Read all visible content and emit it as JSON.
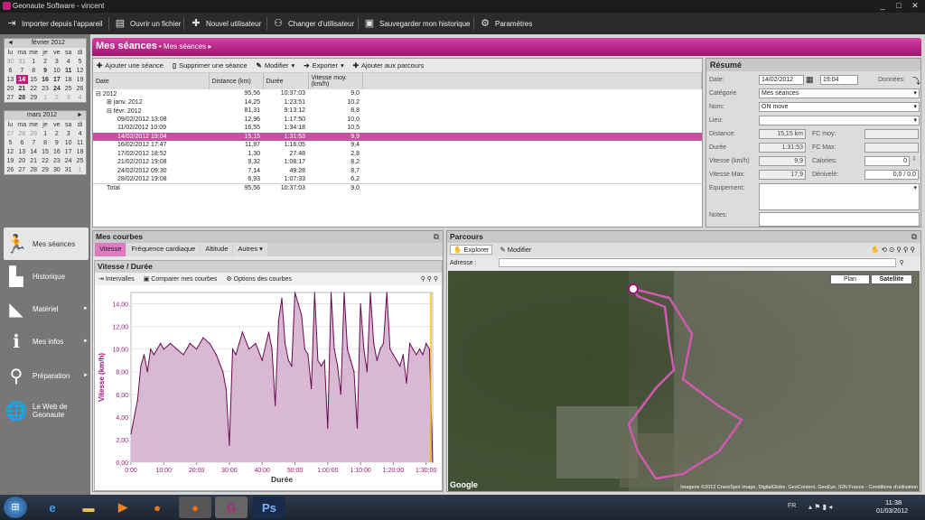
{
  "window": {
    "title": "Geonaute Software - vincent",
    "btn_min": "_",
    "btn_max": "□",
    "btn_close": "✕"
  },
  "toolbar": {
    "items": [
      {
        "label": "Importer depuis l'appareil",
        "icon": "import-icon"
      },
      {
        "label": "Ouvrir un fichier",
        "icon": "open-file-icon"
      },
      {
        "label": "Nouvel utilisateur",
        "icon": "new-user-icon"
      },
      {
        "label": "Changer d'utilisateur",
        "icon": "change-user-icon"
      },
      {
        "label": "Sauvegarder mon historique",
        "icon": "save-icon"
      },
      {
        "label": "Paramètres",
        "icon": "settings-icon"
      }
    ]
  },
  "calendars": [
    {
      "title": "février 2012",
      "prev": "◄",
      "next": "",
      "weekdays": [
        "lu",
        "ma",
        "me",
        "je",
        "ve",
        "sa",
        "di"
      ],
      "rows": [
        [
          "30",
          "31",
          "1",
          "2",
          "3",
          "4",
          "5"
        ],
        [
          "6",
          "7",
          "8",
          "9",
          "10",
          "11",
          "12"
        ],
        [
          "13",
          "14",
          "15",
          "16",
          "17",
          "18",
          "19"
        ],
        [
          "20",
          "21",
          "22",
          "23",
          "24",
          "25",
          "26"
        ],
        [
          "27",
          "28",
          "29",
          "1",
          "2",
          "3",
          "4"
        ]
      ]
    },
    {
      "title": "mars 2012",
      "prev": "",
      "next": "►",
      "weekdays": [
        "lu",
        "ma",
        "me",
        "je",
        "ve",
        "sa",
        "di"
      ],
      "rows": [
        [
          "27",
          "28",
          "29",
          "1",
          "2",
          "3",
          "4"
        ],
        [
          "5",
          "6",
          "7",
          "8",
          "9",
          "10",
          "11"
        ],
        [
          "12",
          "13",
          "14",
          "15",
          "16",
          "17",
          "18"
        ],
        [
          "19",
          "20",
          "21",
          "22",
          "23",
          "24",
          "25"
        ],
        [
          "26",
          "27",
          "28",
          "29",
          "30",
          "31",
          "1"
        ]
      ]
    }
  ],
  "nav": [
    {
      "label": "Mes séances",
      "icon": "runner-icon",
      "active": true
    },
    {
      "label": "Historique",
      "icon": "histogram-icon"
    },
    {
      "label": "Matériel",
      "icon": "shoe-icon",
      "arrow": "►"
    },
    {
      "label": "Mes infos",
      "icon": "info-icon",
      "arrow": "►"
    },
    {
      "label": "Préparation",
      "icon": "magnifier-icon",
      "arrow": "►"
    },
    {
      "label": "Le Web de Geonaute",
      "icon": "globe-icon"
    }
  ],
  "seances": {
    "title": "Mes séances",
    "breadcrumb": "• Mes séances ▸",
    "toolbar": {
      "add": "Ajouter une séance",
      "delete": "Supprimer une séance",
      "edit": "Modifier",
      "export": "Exporter",
      "addparcours": "Ajouter aux parcours"
    },
    "columns": [
      "Date",
      "Distance (km)",
      "Durée",
      "Vitesse moy. (km/h)"
    ],
    "rows": [
      {
        "date": "⊟ 2012",
        "dist": "95,56",
        "dur": "10:37:03",
        "vit": "9,0",
        "indent": 0
      },
      {
        "date": "⊞ janv. 2012",
        "dist": "14,25",
        "dur": "1:23:51",
        "vit": "10,2",
        "indent": 1
      },
      {
        "date": "⊟ févr. 2012",
        "dist": "81,31",
        "dur": "9:13:12",
        "vit": "8,8",
        "indent": 1
      },
      {
        "date": "09/02/2012 13:08",
        "dist": "12,96",
        "dur": "1:17:50",
        "vit": "10,0",
        "indent": 2
      },
      {
        "date": "11/02/2012 10:09",
        "dist": "16,55",
        "dur": "1:34:18",
        "vit": "10,5",
        "indent": 2
      },
      {
        "date": "14/02/2012 19:04",
        "dist": "15,15",
        "dur": "1:31:53",
        "vit": "9,9",
        "indent": 2,
        "hl": true
      },
      {
        "date": "16/02/2012 17:47",
        "dist": "11,97",
        "dur": "1:16:05",
        "vit": "9,4",
        "indent": 2
      },
      {
        "date": "17/02/2012 18:52",
        "dist": "1,30",
        "dur": "27:48",
        "vit": "2,8",
        "indent": 2
      },
      {
        "date": "21/02/2012 19:08",
        "dist": "9,32",
        "dur": "1:08:17",
        "vit": "8,2",
        "indent": 2
      },
      {
        "date": "24/02/2012 09:30",
        "dist": "7,14",
        "dur": "49:28",
        "vit": "8,7",
        "indent": 2
      },
      {
        "date": "28/02/2012 19:08",
        "dist": "6,93",
        "dur": "1:07:33",
        "vit": "6,2",
        "indent": 2
      },
      {
        "date": "Total",
        "dist": "95,56",
        "dur": "10:37:03",
        "vit": "9,0",
        "indent": 1
      }
    ]
  },
  "resume": {
    "title": "Résumé",
    "date_label": "Date:",
    "date": "14/02/2012",
    "time": "19:04",
    "donnees": "Données:",
    "cat_label": "Catégorie",
    "cat": "Mes séances",
    "nom_label": "Nom:",
    "nom": "ON move",
    "lieu_label": "Lieu:",
    "lieu": "",
    "dist_label": "Distance:",
    "dist": "15,15 km",
    "fcmoy_label": "FC moy:",
    "fcmoy": "",
    "duree_label": "Durée",
    "duree": "1:31:53",
    "fcmax_label": "FC Max:",
    "fcmax": "",
    "vit_label": "Vitesse (km/h)",
    "vit": "9,9",
    "cal_label": "Calories:",
    "cal": "0",
    "vmax_label": "Vitesse Max:",
    "vmax": "17,9",
    "deniv_label": "Dénivelé:",
    "deniv": "0,0 / 0,0",
    "equip_label": "Equipement:",
    "notes_label": "Notes:"
  },
  "courbes": {
    "title": "Mes courbes",
    "tabs": [
      "Vitesse",
      "Fréquence cardiaque",
      "Altitude",
      "Autres ▾"
    ],
    "subtitle": "Vitesse / Durée",
    "tools": [
      "Intervalles",
      "Comparer mes courbes",
      "Options des courbes"
    ]
  },
  "chart_data": {
    "type": "area",
    "xlabel": "Durée",
    "ylabel": "Vitesse (km/h)",
    "ylim": [
      0,
      15
    ],
    "yticks": [
      "0,00",
      "2,00",
      "4,00",
      "6,00",
      "8,00",
      "10,00",
      "12,00",
      "14,00"
    ],
    "xticks": [
      "0:00",
      "10:00",
      "20:00",
      "30:00",
      "40:00",
      "50:00",
      "1:00:00",
      "1:10:00",
      "1:20:00",
      "1:30:00"
    ],
    "xlim": [
      0,
      92
    ],
    "x": [
      0,
      1,
      2,
      3,
      4,
      5,
      6,
      7,
      8,
      9,
      10,
      12,
      14,
      16,
      18,
      20,
      22,
      24,
      26,
      28,
      29,
      30,
      31,
      32,
      33,
      34,
      36,
      38,
      40,
      42,
      43,
      44,
      45,
      46,
      47,
      48,
      49,
      50,
      51,
      52,
      53,
      54,
      55,
      56,
      57,
      58,
      59,
      60,
      61,
      62,
      63,
      64,
      65,
      66,
      67,
      68,
      69,
      70,
      71,
      72,
      73,
      74,
      75,
      76,
      77,
      78,
      79,
      80,
      81,
      82,
      83,
      84,
      85,
      86,
      87,
      88,
      89,
      90,
      91,
      92
    ],
    "y": [
      2.5,
      4,
      5.5,
      8.5,
      9.5,
      8,
      10,
      9.5,
      10,
      10.5,
      10,
      10.5,
      10,
      9.5,
      10.5,
      10,
      11,
      10.5,
      9.5,
      8,
      6.5,
      1.5,
      10,
      9.5,
      10.5,
      11.5,
      10,
      10.5,
      9,
      11.5,
      10,
      5,
      12.5,
      14.5,
      10.5,
      9,
      8.5,
      15,
      14,
      13,
      10,
      9.5,
      6.5,
      15,
      9,
      8.5,
      9,
      3,
      15,
      10,
      8.5,
      6,
      15,
      10,
      9,
      8,
      3,
      14,
      10,
      8,
      15,
      10.5,
      9,
      10,
      10.5,
      15,
      10,
      9.5,
      9,
      8.5,
      9.5,
      7,
      10.5,
      10,
      9.5,
      10,
      9.5,
      10.5,
      10,
      0
    ]
  },
  "parcours": {
    "title": "Parcours",
    "explorer": "Explorer",
    "modifier": "Modifier",
    "adresse_label": "Adresse :",
    "adresse": "",
    "btn_plan": "Plan",
    "btn_sat": "Satellite",
    "attribution": "Imagerie ©2012 Cnes/Spot Image, DigitalGlobe, GeoContent, GeoEye, IGN France - Conditions d'utilisation",
    "google": "Google"
  },
  "taskbar": {
    "lang": "FR",
    "time": "11:38",
    "date": "01/03/2012",
    "ps": "Ps"
  }
}
